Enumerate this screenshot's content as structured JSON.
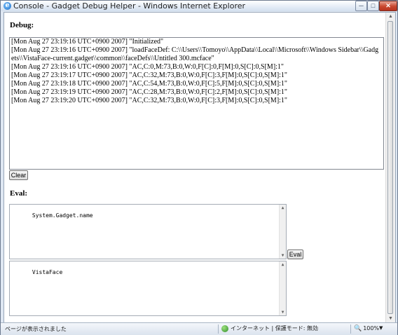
{
  "window": {
    "title": "Console - Gadget Debug Helper - Windows Internet Explorer",
    "minimize_glyph": "─",
    "maximize_glyph": "□",
    "close_glyph": "✕"
  },
  "debug": {
    "label": "Debug:",
    "log": [
      "[Mon Aug 27 23:19:16 UTC+0900 2007] \"Initialized\"",
      "[Mon Aug 27 23:19:16 UTC+0900 2007] \"loadFaceDef: C:\\\\Users\\\\Tomoyo\\\\AppData\\\\Local\\\\Microsoft\\\\Windows Sidebar\\\\Gadgets\\\\VistaFace-current.gadget\\\\common\\\\faceDefs\\\\Untitled 300.mcface\"",
      "[Mon Aug 27 23:19:16 UTC+0900 2007] \"AC,C:0,M:73,B:0,W:0,F[C]:0,F[M]:0,S[C]:0,S[M]:1\"",
      "[Mon Aug 27 23:19:17 UTC+0900 2007] \"AC,C:32,M:73,B:0,W:0,F[C]:3,F[M]:0,S[C]:0,S[M]:1\"",
      "[Mon Aug 27 23:19:18 UTC+0900 2007] \"AC,C:54,M:73,B:0,W:0,F[C]:5,F[M]:0,S[C]:0,S[M]:1\"",
      "[Mon Aug 27 23:19:19 UTC+0900 2007] \"AC,C:28,M:73,B:0,W:0,F[C]:2,F[M]:0,S[C]:0,S[M]:1\"",
      "[Mon Aug 27 23:19:20 UTC+0900 2007] \"AC,C:32,M:73,B:0,W:0,F[C]:3,F[M]:0,S[C]:0,S[M]:1\""
    ],
    "clear_label": "Clear"
  },
  "eval": {
    "label": "Eval:",
    "input_value": "System.Gadget.name",
    "button_label": "Eval",
    "output_value": "VistaFace"
  },
  "statusbar": {
    "status_text": "ページが表示されました",
    "zone_text": "インターネット | 保護モード: 無効",
    "zoom_text": "100%"
  }
}
